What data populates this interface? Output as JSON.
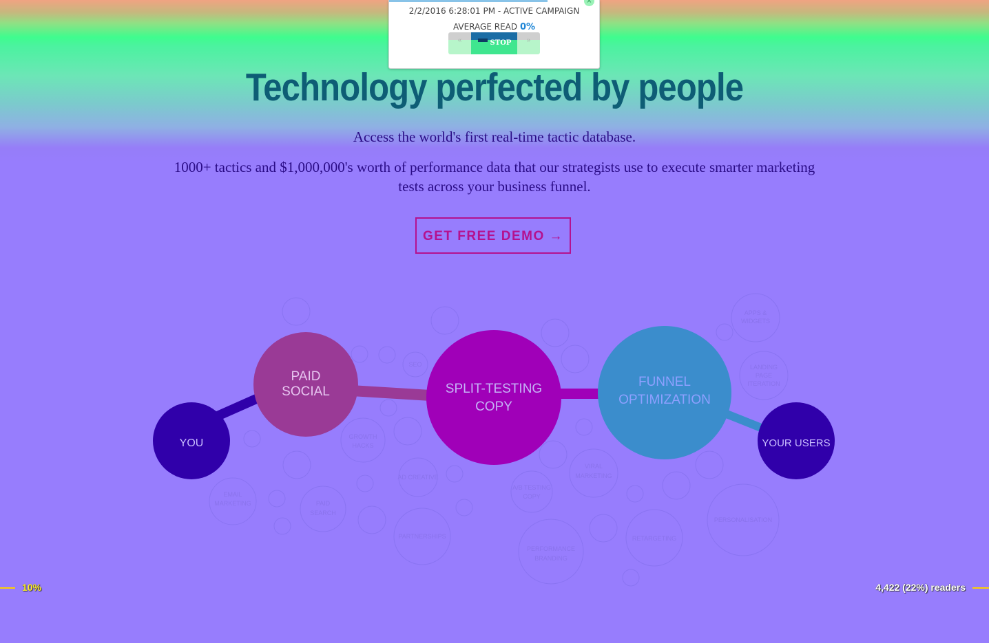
{
  "popup": {
    "date_status": "2/2/2016 6:28:01 PM - ACTIVE CAMPAIGN",
    "average_read_label": "AVERAGE READ",
    "average_read_value": "0%",
    "prev_glyph": "«",
    "stop_label": "STOP",
    "next_glyph": "»",
    "close_glyph": "×"
  },
  "hero": {
    "headline": "Technology perfected by people",
    "subtitle": "Access the world's first real-time tactic database.",
    "description": "1000+ tactics and $1,000,000's worth of performance data that our strategists use to execute smarter marketing tests across your business funnel.",
    "cta_label": "GET FREE DEMO →"
  },
  "diagram": {
    "main_nodes": [
      {
        "label_line1": "YOU",
        "label_line2": "",
        "color": "#3000aa"
      },
      {
        "label_line1": "PAID",
        "label_line2": "SOCIAL",
        "color": "#9a3a96"
      },
      {
        "label_line1": "SPLIT-TESTING",
        "label_line2": "COPY",
        "color": "#a000b8"
      },
      {
        "label_line1": "FUNNEL",
        "label_line2": "OPTIMIZATION",
        "color": "#3b8dcc"
      },
      {
        "label_line1": "YOUR USERS",
        "label_line2": "",
        "color": "#3000aa"
      }
    ],
    "tactics": {
      "seo": "SEO",
      "growth_hacks_1": "GROWTH",
      "growth_hacks_2": "HACKS",
      "ad_creative": "AD CREATIVE",
      "email_1": "EMAIL",
      "email_2": "MARKETING",
      "paid_search_1": "PAID",
      "paid_search_2": "SEARCH",
      "partnerships": "PARTNERSHIPS",
      "ab_testing_1": "A/B TESTING",
      "ab_testing_2": "COPY",
      "viral_1": "VIRAL",
      "viral_2": "MARKETING",
      "perf_branding_1": "PERFORMANCE",
      "perf_branding_2": "BRANDING",
      "retargeting": "RETARGETING",
      "apps_1": "APPS &",
      "apps_2": "WIDGETS",
      "landing_1": "LANDING",
      "landing_2": "PAGE",
      "landing_3": "ITERATION",
      "personalisation": "PERSONALISATION"
    }
  },
  "markers": {
    "scroll_percent": "10%",
    "readers": "4,422 (22%) readers"
  },
  "colors": {
    "headline": "#0e5d75",
    "body_text": "#2a0c86",
    "cta": "#b4118f",
    "background": "#977dfd",
    "marker": "#ffd000"
  }
}
